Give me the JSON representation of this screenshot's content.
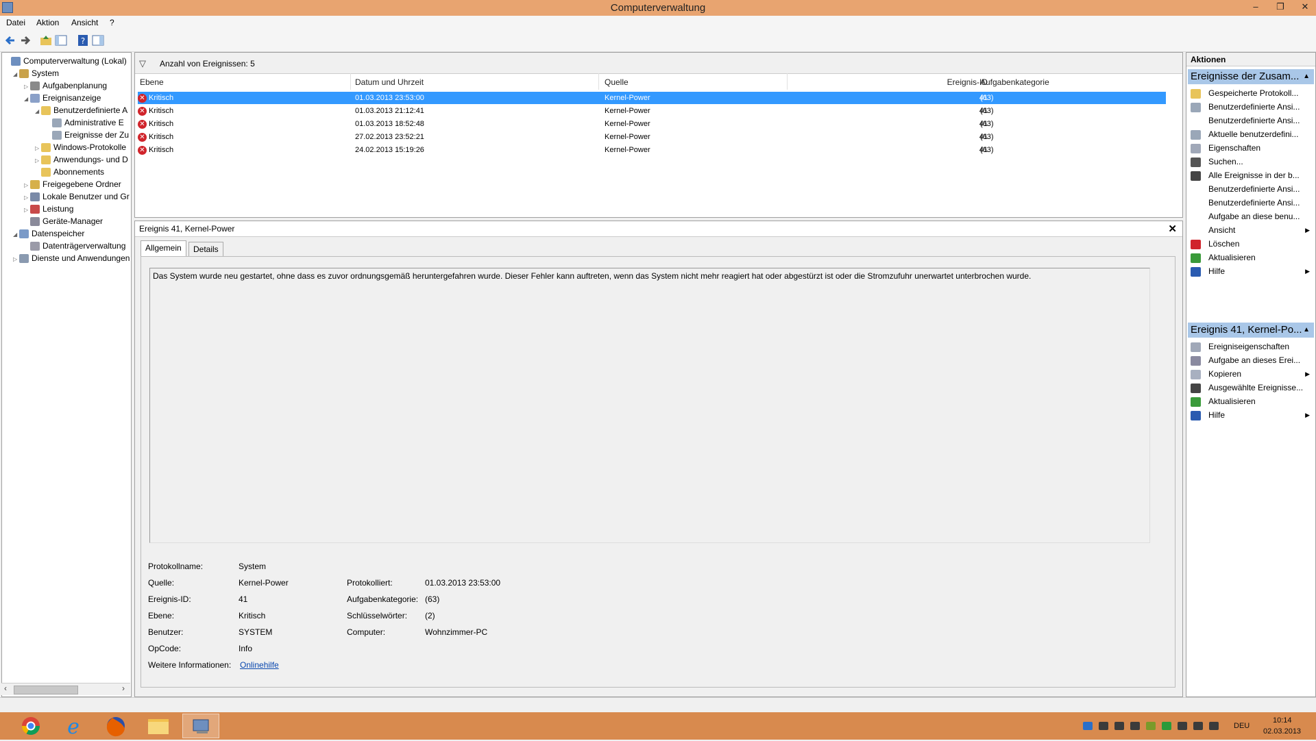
{
  "window": {
    "title": "Computerverwaltung",
    "controls": [
      "–",
      "❐",
      "✕"
    ]
  },
  "menu": [
    "Datei",
    "Aktion",
    "Ansicht",
    "?"
  ],
  "tree": [
    {
      "label": "Computerverwaltung (Lokal)",
      "icon": "computer-management-icon",
      "expander": ""
    },
    {
      "label": "System",
      "icon": "tools-icon",
      "expander": "◢"
    },
    {
      "label": "Aufgabenplanung",
      "icon": "clock-icon",
      "expander": "▷"
    },
    {
      "label": "Ereignisanzeige",
      "icon": "event-viewer-icon",
      "expander": "◢"
    },
    {
      "label": "Benutzerdefinierte A",
      "icon": "folder-icon",
      "expander": "◢"
    },
    {
      "label": "Administrative E",
      "icon": "filter-icon",
      "expander": ""
    },
    {
      "label": "Ereignisse der Zu",
      "icon": "filter-icon",
      "expander": ""
    },
    {
      "label": "Windows-Protokolle",
      "icon": "folder-icon",
      "expander": "▷"
    },
    {
      "label": "Anwendungs- und D",
      "icon": "folder-icon",
      "expander": "▷"
    },
    {
      "label": "Abonnements",
      "icon": "subscriptions-icon",
      "expander": ""
    },
    {
      "label": "Freigegebene Ordner",
      "icon": "shared-folder-icon",
      "expander": "▷"
    },
    {
      "label": "Lokale Benutzer und Gr",
      "icon": "users-icon",
      "expander": "▷"
    },
    {
      "label": "Leistung",
      "icon": "performance-icon",
      "expander": "▷"
    },
    {
      "label": "Geräte-Manager",
      "icon": "device-manager-icon",
      "expander": ""
    },
    {
      "label": "Datenspeicher",
      "icon": "storage-icon",
      "expander": "◢"
    },
    {
      "label": "Datenträgerverwaltung",
      "icon": "disk-icon",
      "expander": ""
    },
    {
      "label": "Dienste und Anwendungen",
      "icon": "services-icon",
      "expander": "▷"
    }
  ],
  "events": {
    "count_label": "Anzahl von Ereignissen: 5",
    "columns": [
      "Ebene",
      "Datum und Uhrzeit",
      "Quelle",
      "Ereignis-ID",
      "Aufgabenkategorie"
    ],
    "rows": [
      {
        "level": "Kritisch",
        "date": "01.03.2013 23:53:00",
        "source": "Kernel-Power",
        "id": "41",
        "category": "(63)"
      },
      {
        "level": "Kritisch",
        "date": "01.03.2013 21:12:41",
        "source": "Kernel-Power",
        "id": "41",
        "category": "(63)"
      },
      {
        "level": "Kritisch",
        "date": "01.03.2013 18:52:48",
        "source": "Kernel-Power",
        "id": "41",
        "category": "(63)"
      },
      {
        "level": "Kritisch",
        "date": "27.02.2013 23:52:21",
        "source": "Kernel-Power",
        "id": "41",
        "category": "(63)"
      },
      {
        "level": "Kritisch",
        "date": "24.02.2013 15:19:26",
        "source": "Kernel-Power",
        "id": "41",
        "category": "(63)"
      }
    ],
    "selected_index": 0
  },
  "detail": {
    "title": "Ereignis 41, Kernel-Power",
    "tabs": [
      "Allgemein",
      "Details"
    ],
    "description": "Das System wurde neu gestartet, ohne dass es zuvor ordnungsgemäß heruntergefahren wurde. Dieser Fehler kann auftreten, wenn das System nicht mehr reagiert hat oder abgestürzt ist oder die Stromzufuhr unerwartet unterbrochen wurde.",
    "fields": {
      "log_name_label": "Protokollname:",
      "log_name": "System",
      "source_label": "Quelle:",
      "source": "Kernel-Power",
      "logged_label": "Protokolliert:",
      "logged": "01.03.2013 23:53:00",
      "event_id_label": "Ereignis-ID:",
      "event_id": "41",
      "task_category_label": "Aufgabenkategorie:",
      "task_category": "(63)",
      "level_label": "Ebene:",
      "level": "Kritisch",
      "keywords_label": "Schlüsselwörter:",
      "keywords": "(2)",
      "user_label": "Benutzer:",
      "user": "SYSTEM",
      "computer_label": "Computer:",
      "computer": "Wohnzimmer-PC",
      "opcode_label": "OpCode:",
      "opcode": "Info",
      "more_info_label": "Weitere Informationen:",
      "more_info_link": "Onlinehilfe"
    }
  },
  "actions": {
    "header": "Aktionen",
    "section1": {
      "title": "Ereignisse der Zusam...",
      "items": [
        {
          "label": "Gespeicherte Protokoll...",
          "icon": "open-log-icon",
          "sub": false
        },
        {
          "label": "Benutzerdefinierte Ansi...",
          "icon": "filter-icon",
          "sub": false
        },
        {
          "label": "Benutzerdefinierte Ansi...",
          "icon": "",
          "sub": false
        },
        {
          "label": "Aktuelle benutzerdefini...",
          "icon": "filter-icon",
          "sub": false
        },
        {
          "label": "Eigenschaften",
          "icon": "properties-icon",
          "sub": false
        },
        {
          "label": "Suchen...",
          "icon": "binoculars-icon",
          "sub": false
        },
        {
          "label": "Alle Ereignisse in der b...",
          "icon": "save-icon",
          "sub": false
        },
        {
          "label": "Benutzerdefinierte Ansi...",
          "icon": "",
          "sub": false
        },
        {
          "label": "Benutzerdefinierte Ansi...",
          "icon": "",
          "sub": false
        },
        {
          "label": "Aufgabe an diese benu...",
          "icon": "",
          "sub": false
        },
        {
          "label": "Ansicht",
          "icon": "",
          "sub": true
        },
        {
          "label": "Löschen",
          "icon": "delete-icon",
          "sub": false
        },
        {
          "label": "Aktualisieren",
          "icon": "refresh-icon",
          "sub": false
        },
        {
          "label": "Hilfe",
          "icon": "help-icon",
          "sub": true
        }
      ]
    },
    "section2": {
      "title": "Ereignis 41, Kernel-Po...",
      "items": [
        {
          "label": "Ereigniseigenschaften",
          "icon": "properties-icon",
          "sub": false
        },
        {
          "label": "Aufgabe an dieses Erei...",
          "icon": "task-icon",
          "sub": false
        },
        {
          "label": "Kopieren",
          "icon": "copy-icon",
          "sub": true
        },
        {
          "label": "Ausgewählte Ereignisse...",
          "icon": "save-icon",
          "sub": false
        },
        {
          "label": "Aktualisieren",
          "icon": "refresh-icon",
          "sub": false
        },
        {
          "label": "Hilfe",
          "icon": "help-icon",
          "sub": true
        }
      ]
    }
  },
  "taskbar": {
    "apps": [
      "chrome-icon",
      "internet-explorer-icon",
      "firefox-icon",
      "file-explorer-icon",
      "computer-management-icon"
    ],
    "language": "DEU",
    "time": "10:14",
    "date": "02.03.2013"
  }
}
